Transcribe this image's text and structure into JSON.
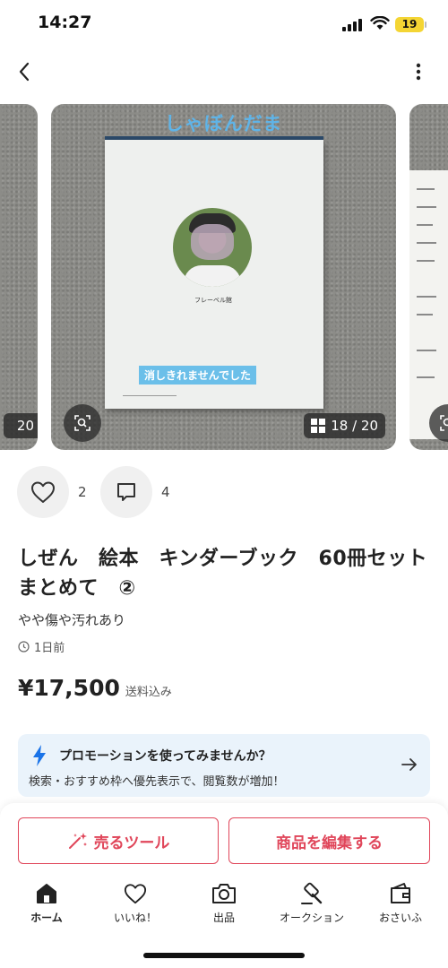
{
  "status_bar": {
    "time": "14:27",
    "battery": "19"
  },
  "gallery": {
    "left_counter": "20",
    "counter": "18 / 20",
    "book_title": "しゃぼんだま",
    "erase_label": "消しきれませんでした"
  },
  "actions": {
    "likes": "2",
    "comments": "4"
  },
  "item": {
    "title": "しぜん　絵本　キンダーブック　60冊セット　まとめて　②",
    "condition": "やや傷や汚れあり",
    "posted": "1日前",
    "price": "¥17,500",
    "shipping": "送料込み"
  },
  "promo": {
    "title": "プロモーションを使ってみませんか？",
    "subtitle": "検索・おすすめ枠へ優先表示で、閲覧数が増加！"
  },
  "buttons": {
    "sell_tool": "売るツール",
    "edit_item": "商品を編集する"
  },
  "tabs": [
    {
      "label": "ホーム",
      "icon": "home-icon"
    },
    {
      "label": "いいね！",
      "icon": "heart-icon"
    },
    {
      "label": "出品",
      "icon": "camera-icon"
    },
    {
      "label": "オークション",
      "icon": "gavel-icon"
    },
    {
      "label": "おさいふ",
      "icon": "wallet-icon"
    }
  ],
  "colors": {
    "accent": "#e0465a",
    "promo_bg": "#eaf3fb",
    "bolt": "#1a73e8"
  }
}
